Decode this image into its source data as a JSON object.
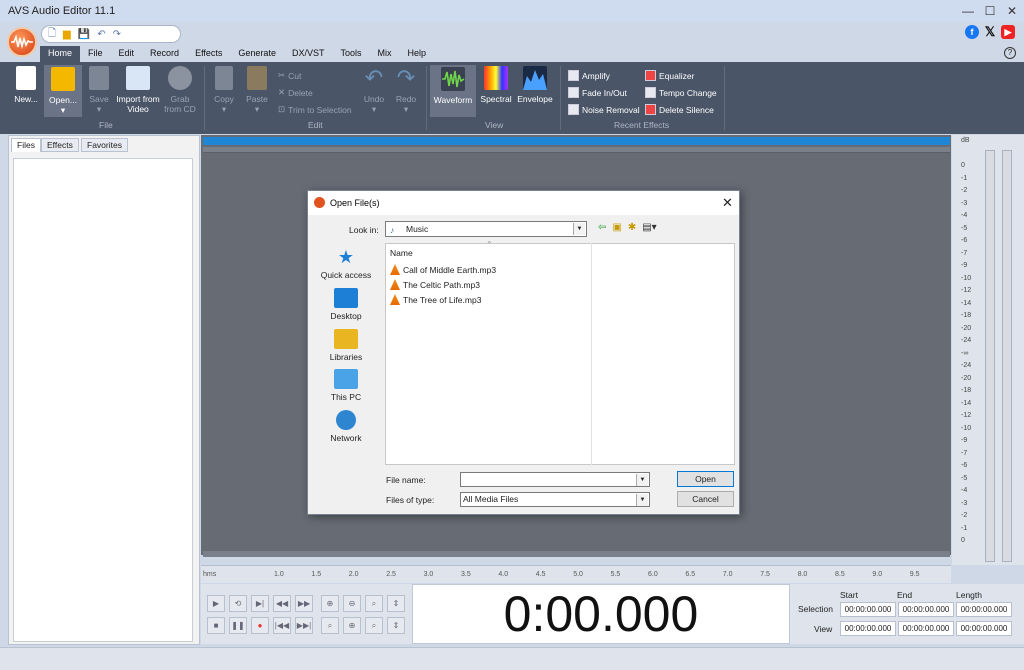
{
  "app": {
    "title": "AVS Audio Editor 11.1"
  },
  "menu": [
    "Home",
    "File",
    "Edit",
    "Record",
    "Effects",
    "Generate",
    "DX/VST",
    "Tools",
    "Mix",
    "Help"
  ],
  "ribbon": {
    "file_group": {
      "label": "File",
      "new": "New...",
      "open": "Open...",
      "save": "Save",
      "import": "Import from Video",
      "grab": "Grab from CD"
    },
    "edit_group": {
      "label": "Edit",
      "copy": "Copy",
      "paste": "Paste",
      "cut": "Cut",
      "delete": "Delete",
      "trim": "Trim to Selection",
      "undo": "Undo",
      "redo": "Redo"
    },
    "view_group": {
      "label": "View",
      "waveform": "Waveform",
      "spectral": "Spectral",
      "envelope": "Envelope"
    },
    "effects_group": {
      "label": "Recent Effects",
      "amplify": "Amplify",
      "fade": "Fade In/Out",
      "noise": "Noise Removal",
      "equalizer": "Equalizer",
      "tempo": "Tempo Change",
      "silence": "Delete Silence"
    }
  },
  "left_tabs": [
    "Files",
    "Effects",
    "Favorites"
  ],
  "ruler": {
    "unit": "hms",
    "ticks": [
      "1.0",
      "1.5",
      "2.0",
      "2.5",
      "3.0",
      "3.5",
      "4.0",
      "4.5",
      "5.0",
      "5.5",
      "6.0",
      "6.5",
      "7.0",
      "7.5",
      "8.0",
      "8.5",
      "9.0",
      "9.5"
    ]
  },
  "db_scale": {
    "unit": "dB",
    "labels": [
      "0",
      "-1",
      "-2",
      "-3",
      "-4",
      "-5",
      "-6",
      "-7",
      "-9",
      "-10",
      "-12",
      "-14",
      "-18",
      "-20",
      "-24",
      "-∞",
      "-24",
      "-20",
      "-18",
      "-14",
      "-12",
      "-10",
      "-9",
      "-7",
      "-6",
      "-5",
      "-4",
      "-3",
      "-2",
      "-1",
      "0"
    ]
  },
  "time_display": "0:00.000",
  "selection": {
    "headers": [
      "Start",
      "End",
      "Length"
    ],
    "rows": [
      {
        "label": "Selection",
        "values": [
          "00:00:00.000",
          "00:00:00.000",
          "00:00:00.000"
        ]
      },
      {
        "label": "View",
        "values": [
          "00:00:00.000",
          "00:00:00.000",
          "00:00:00.000"
        ]
      }
    ]
  },
  "dialog": {
    "title": "Open File(s)",
    "look_in_label": "Look in:",
    "look_in_value": "Music",
    "places": [
      "Quick access",
      "Desktop",
      "Libraries",
      "This PC",
      "Network"
    ],
    "column_header": "Name",
    "files": [
      "Call of Middle Earth.mp3",
      "The Celtic Path.mp3",
      "The Tree of Life.mp3"
    ],
    "file_name_label": "File name:",
    "file_name_value": "",
    "files_of_type_label": "Files of type:",
    "files_of_type_value": "All Media Files",
    "open_button": "Open",
    "cancel_button": "Cancel"
  }
}
